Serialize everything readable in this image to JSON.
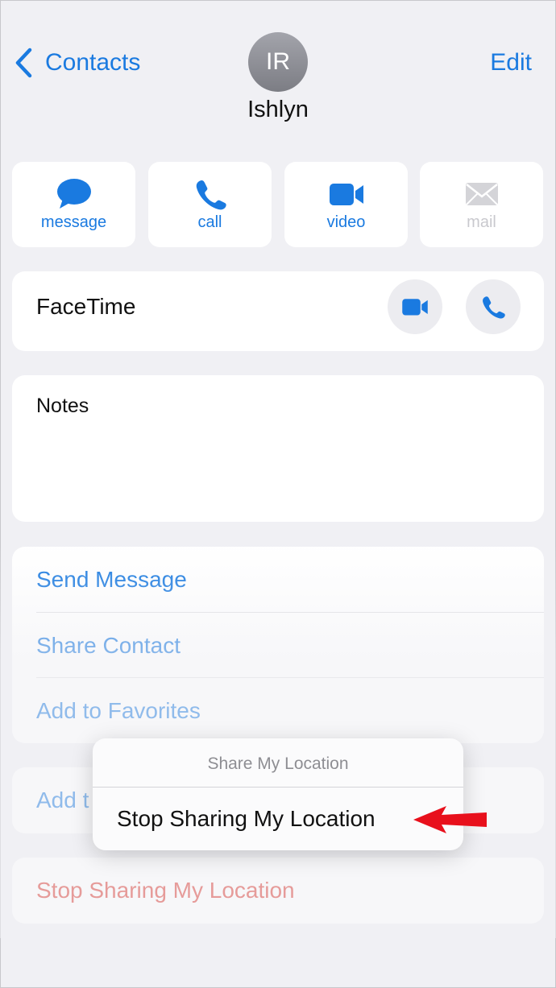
{
  "nav": {
    "back_label": "Contacts",
    "edit_label": "Edit"
  },
  "contact": {
    "initials": "IR",
    "name": "Ishlyn"
  },
  "actions": [
    {
      "label": "message",
      "icon": "message-bubble-icon",
      "enabled": true
    },
    {
      "label": "call",
      "icon": "phone-icon",
      "enabled": true
    },
    {
      "label": "video",
      "icon": "video-camera-icon",
      "enabled": true
    },
    {
      "label": "mail",
      "icon": "envelope-icon",
      "enabled": false
    }
  ],
  "facetime": {
    "label": "FaceTime"
  },
  "notes": {
    "label": "Notes"
  },
  "list": {
    "send_message": "Send Message",
    "share_contact": "Share Contact",
    "add_favorites": "Add to Favorites",
    "add_partial": "Add t"
  },
  "stop_sharing": "Stop Sharing My Location",
  "popup": {
    "title": "Share My Location",
    "option": "Stop Sharing My Location"
  },
  "colors": {
    "accent": "#1a7ae0",
    "destructive": "#d9342b",
    "arrow": "#e8101c"
  }
}
